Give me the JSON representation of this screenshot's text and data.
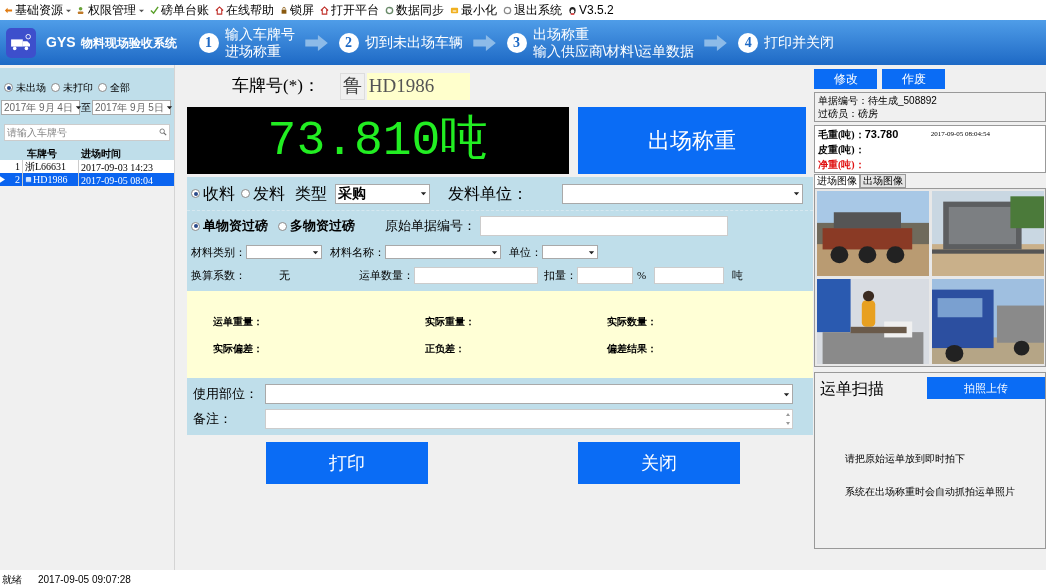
{
  "menu": [
    {
      "label": "基础资源",
      "dropdown": true
    },
    {
      "label": "权限管理",
      "dropdown": true
    },
    {
      "label": "磅单台账",
      "dropdown": false
    },
    {
      "label": "在线帮助",
      "dropdown": false
    },
    {
      "label": "锁屏",
      "dropdown": false
    },
    {
      "label": "打开平台",
      "dropdown": false
    },
    {
      "label": "数据同步",
      "dropdown": false
    },
    {
      "label": "最小化",
      "dropdown": false
    },
    {
      "label": "退出系统",
      "dropdown": false
    },
    {
      "label": "V3.5.2",
      "dropdown": false
    }
  ],
  "header": {
    "app_code": "GYS",
    "app_name": "物料现场验收系统",
    "steps": [
      {
        "number": "1",
        "lines": [
          "输入车牌号",
          "进场称重"
        ]
      },
      {
        "number": "2",
        "lines": [
          "切到未出场车辆"
        ]
      },
      {
        "number": "3",
        "lines": [
          "出场称重",
          "输入供应商\\材料\\运单数据"
        ]
      },
      {
        "number": "4",
        "lines": [
          "打印并关闭"
        ]
      }
    ]
  },
  "sidebar": {
    "filters": [
      {
        "label": "未出场",
        "selected": true
      },
      {
        "label": "未打印",
        "selected": false
      },
      {
        "label": "全部",
        "selected": false
      }
    ],
    "date_from": "2017年  9月  4日",
    "date_separator": "至",
    "date_to": "2017年  9月  5日",
    "search": {
      "placeholder": "请输入车牌号"
    },
    "table": {
      "columns": [
        "车牌号",
        "进场时间"
      ],
      "rows": [
        {
          "index": "1",
          "plate": "浙L66631",
          "time": "2017-09-03 14:23",
          "selected": false,
          "current": false
        },
        {
          "index": "2",
          "plate": "HD1986",
          "time": "2017-09-05 08:04",
          "selected": true,
          "current": true
        }
      ]
    }
  },
  "main": {
    "plate_label": "车牌号(*)：",
    "province": "鲁",
    "plate_number": "HD1986",
    "weight": "73.810吨",
    "weigh_button": "出场称重",
    "direction": [
      {
        "label": "收料",
        "selected": true
      },
      {
        "label": "发料",
        "selected": false
      }
    ],
    "type_label": "类型",
    "type_value": "采购",
    "unit_label": "发料单位：",
    "mode": [
      {
        "label": "单物资过磅",
        "selected": true
      },
      {
        "label": "多物资过磅",
        "selected": false
      }
    ],
    "doc_label": "原始单据编号：",
    "category_label": "材料类别：",
    "material_label": "材料名称：",
    "measure_label": "单位：",
    "factor_label": "换算系数：",
    "factor_value": "无",
    "waybill_qty_label": "运单数量：",
    "deduct_label": "扣量：",
    "percent": "%",
    "ton": "吨",
    "summary": [
      [
        "运单重量：",
        "实际重量：",
        "实际数量："
      ],
      [
        "实际偏差：",
        "正负差：",
        "偏差结果："
      ]
    ],
    "usage_label": "使用部位：",
    "note_label": "备注：",
    "buttons": [
      "打印",
      "关闭"
    ]
  },
  "right": {
    "buttons": [
      "修改",
      "作废"
    ],
    "info": [
      "单据编号：待生成_508892",
      "过磅员：磅房"
    ],
    "gross_label": "毛重(吨)：",
    "gross_value": "73.780",
    "gross_time": "2017-09-05 08:04:54",
    "tare_label": "皮重(吨)：",
    "net_label": "净重(吨)：",
    "tabs": [
      {
        "label": "进场图像",
        "selected": true
      },
      {
        "label": "出场图像",
        "selected": false
      }
    ],
    "photos": [
      {
        "kind": "picture"
      },
      {
        "kind": "picture"
      },
      {
        "kind": "picture"
      },
      {
        "kind": "picture"
      }
    ],
    "scan": {
      "title": "运单扫描",
      "button": "拍照上传",
      "hints": [
        "请把原始运单放到即时拍下",
        "系统在出场称重时会自动抓拍运单照片"
      ]
    }
  },
  "status_bar": {
    "text": "就绪",
    "time": "2017-09-05 09:07:28"
  }
}
